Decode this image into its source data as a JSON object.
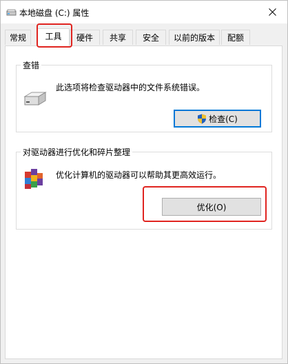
{
  "window": {
    "title": "本地磁盘 (C:) 属性",
    "close_icon": "close-icon"
  },
  "tabs": [
    {
      "label": "常规",
      "active": false
    },
    {
      "label": "工具",
      "active": true
    },
    {
      "label": "硬件",
      "active": false
    },
    {
      "label": "共享",
      "active": false
    },
    {
      "label": "安全",
      "active": false
    },
    {
      "label": "以前的版本",
      "active": false
    },
    {
      "label": "配额",
      "active": false
    }
  ],
  "check_section": {
    "title": "查错",
    "description": "此选项将检查驱动器中的文件系统错误。",
    "button_label": "检查(C)",
    "button_mnemonic": "C",
    "icon": "drive-icon",
    "button_icon": "uac-shield-icon"
  },
  "optimize_section": {
    "title": "对驱动器进行优化和碎片整理",
    "description": "优化计算机的驱动器可以帮助其更高效运行。",
    "button_label": "优化(O)",
    "button_mnemonic": "O",
    "icon": "defrag-icon"
  },
  "annotations": {
    "highlight_color": "#e0231f"
  }
}
